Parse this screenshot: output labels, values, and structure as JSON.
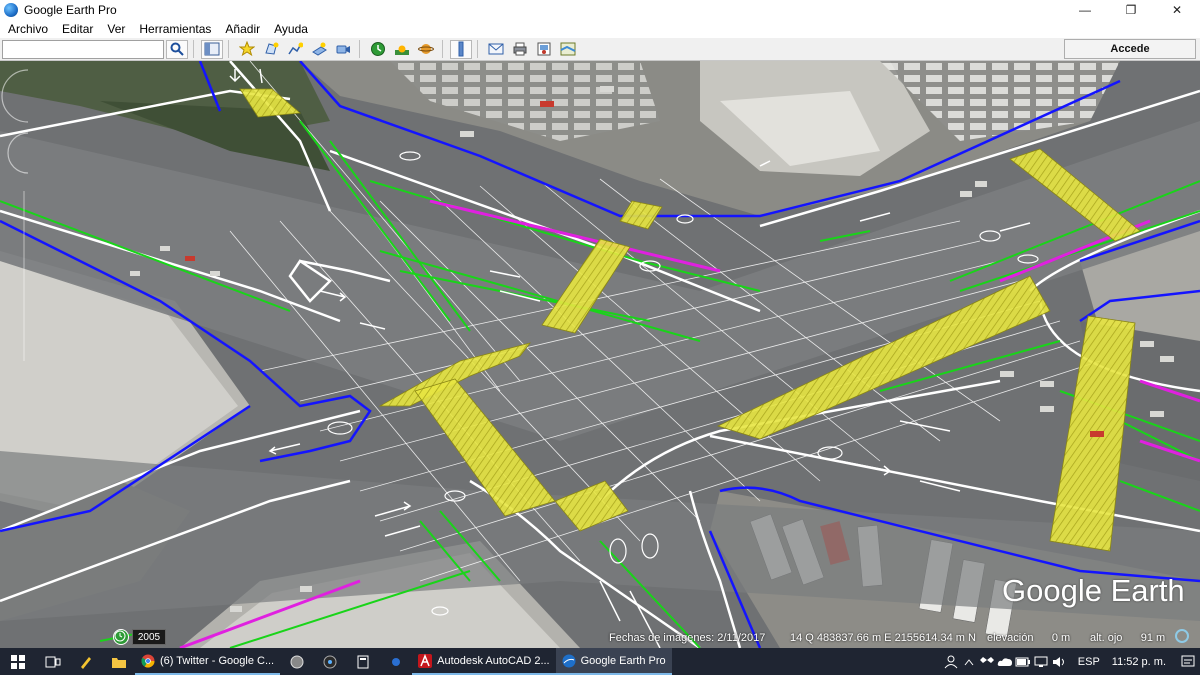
{
  "window": {
    "title": "Google Earth Pro",
    "minimize_label": "—",
    "maximize_label": "❐",
    "close_label": "✕"
  },
  "menu": {
    "items": [
      "Archivo",
      "Editar",
      "Ver",
      "Herramientas",
      "Añadir",
      "Ayuda"
    ]
  },
  "toolbar": {
    "search_value": "",
    "login_label": "Accede",
    "icons": [
      "search-icon",
      "sidebar-icon",
      "placemark-icon",
      "polygon-icon",
      "path-icon",
      "image-overlay-icon",
      "record-tour-icon",
      "historical-imagery-icon",
      "sunlight-icon",
      "planets-icon",
      "ruler-icon",
      "email-icon",
      "print-icon",
      "save-image-icon",
      "view-in-maps-icon"
    ]
  },
  "map": {
    "watermark": "Google Earth",
    "year": "2005",
    "imagery_date": "Fechas de imágenes: 2/11/2017",
    "coordinates": "14 Q 483837.66 m E 2155614.34 m N",
    "elevation": "elevación      0 m",
    "eye_alt": "alt. ojo      91 m",
    "colors": {
      "lane_green": "#19d419",
      "boundary_blue": "#1414ff",
      "bike_magenta": "#e020e0",
      "crossing_yellow": "#f2f23a",
      "road_white": "#ffffff"
    }
  },
  "taskbar": {
    "apps": [
      {
        "label": "(6) Twitter - Google C...",
        "icon": "chrome-icon",
        "active": false
      },
      {
        "label": "Autodesk AutoCAD 2...",
        "icon": "autocad-icon",
        "active": false
      },
      {
        "label": "Google Earth Pro",
        "icon": "google-earth-icon",
        "active": true
      }
    ],
    "language": "ESP",
    "time": "11:52 p. m."
  }
}
